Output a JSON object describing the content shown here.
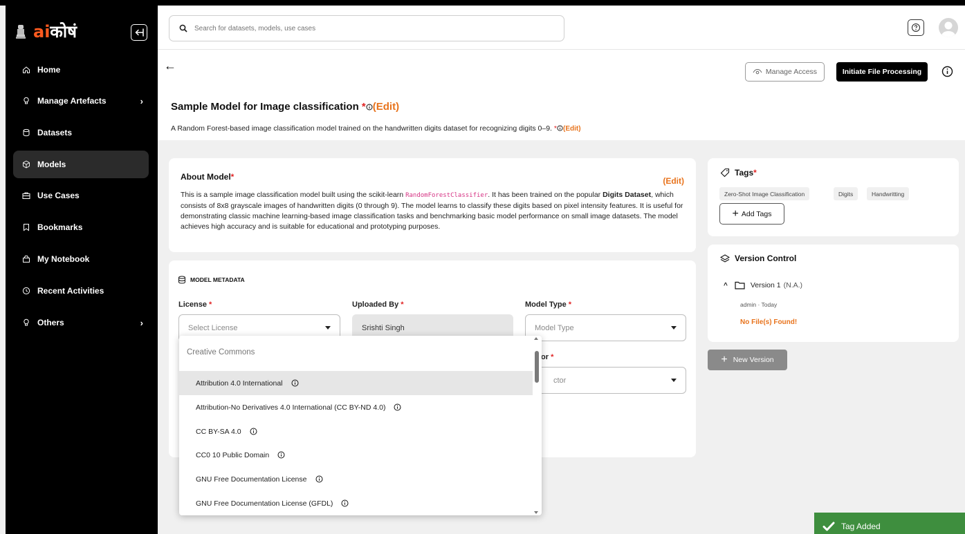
{
  "brand": {
    "ai": "ai",
    "rest": "कोषं"
  },
  "sidebar": {
    "items": [
      {
        "label": "Home",
        "icon": "home-icon"
      },
      {
        "label": "Manage Artefacts",
        "icon": "bulb-icon",
        "chevron": "›"
      },
      {
        "label": "Datasets",
        "icon": "database-icon"
      },
      {
        "label": "Models",
        "icon": "cube-icon",
        "active": true
      },
      {
        "label": "Use Cases",
        "icon": "briefcase-icon"
      },
      {
        "label": "Bookmarks",
        "icon": "bookmark-icon"
      },
      {
        "label": "My Notebook",
        "icon": "notebook-icon"
      },
      {
        "label": "Recent Activities",
        "icon": "clock-icon"
      },
      {
        "label": "Others",
        "icon": "bulb-icon",
        "chevron": "›"
      }
    ]
  },
  "header": {
    "search_placeholder": "Search for datasets, models, use cases",
    "help_icon": "question-icon"
  },
  "page": {
    "back": "←",
    "manage_access": "Manage Access",
    "initiate": "Initiate File Processing",
    "title": "Sample Model for Image classification",
    "req": "*",
    "edit": "(Edit)",
    "description": "A Random Forest-based image classification model trained on the handwritten digits dataset for recognizing digits 0–9."
  },
  "about": {
    "title": "About Model",
    "req": "*",
    "edit": "(Edit)",
    "body_1": "This is a sample image classification model built using the scikit-learn ",
    "code": "RandomForestClassifier",
    "body_2": ". It has been trained on the popular ",
    "bold_1": "Digits Dataset",
    "body_3": ", which consists of 8x8 grayscale images of handwritten digits (0 through 9). The model learns to classify these digits based on pixel intensity features. It is useful for demonstrating classic machine learning-based image classification tasks and benchmarking basic model performance on small image datasets. The model achieves high accuracy and is suitable for educational and prototyping purposes."
  },
  "metadata": {
    "heading": "MODEL METADATA",
    "license_label": "License",
    "license_placeholder": "Select License",
    "uploaded_label": "Uploaded By",
    "uploaded_value": "Srishti Singh",
    "type_label": "Model Type",
    "type_placeholder": "Model Type",
    "sector_label_partial": "or",
    "sector_placeholder_partial": "ctor",
    "req": "*"
  },
  "license_dropdown": {
    "group": "Creative Commons",
    "options": [
      "Attribution 4.0 International",
      "Attribution-No Derivatives 4.0 International (CC BY-ND 4.0)",
      "CC BY-SA 4.0",
      "CC0 10 Public Domain",
      "GNU Free Documentation License",
      "GNU Free Documentation License (GFDL)"
    ],
    "selected_index": 0
  },
  "tags": {
    "title": "Tags",
    "req": "*",
    "items": [
      "Zero-Shot Image Classification",
      "Digits",
      "Handwritting"
    ],
    "add_label": "Add Tags"
  },
  "version_control": {
    "title": "Version Control",
    "version": "Version 1",
    "version_note": "(N.A.)",
    "meta": "admin · Today",
    "no_files": "No File(s) Found!",
    "new_version": "New Version"
  },
  "toast": {
    "message": "Tag Added"
  },
  "colors": {
    "accent": "#e8731c",
    "brand_orange": "#ff5a1f",
    "required": "#e02424",
    "toast": "#3e8e3e"
  }
}
